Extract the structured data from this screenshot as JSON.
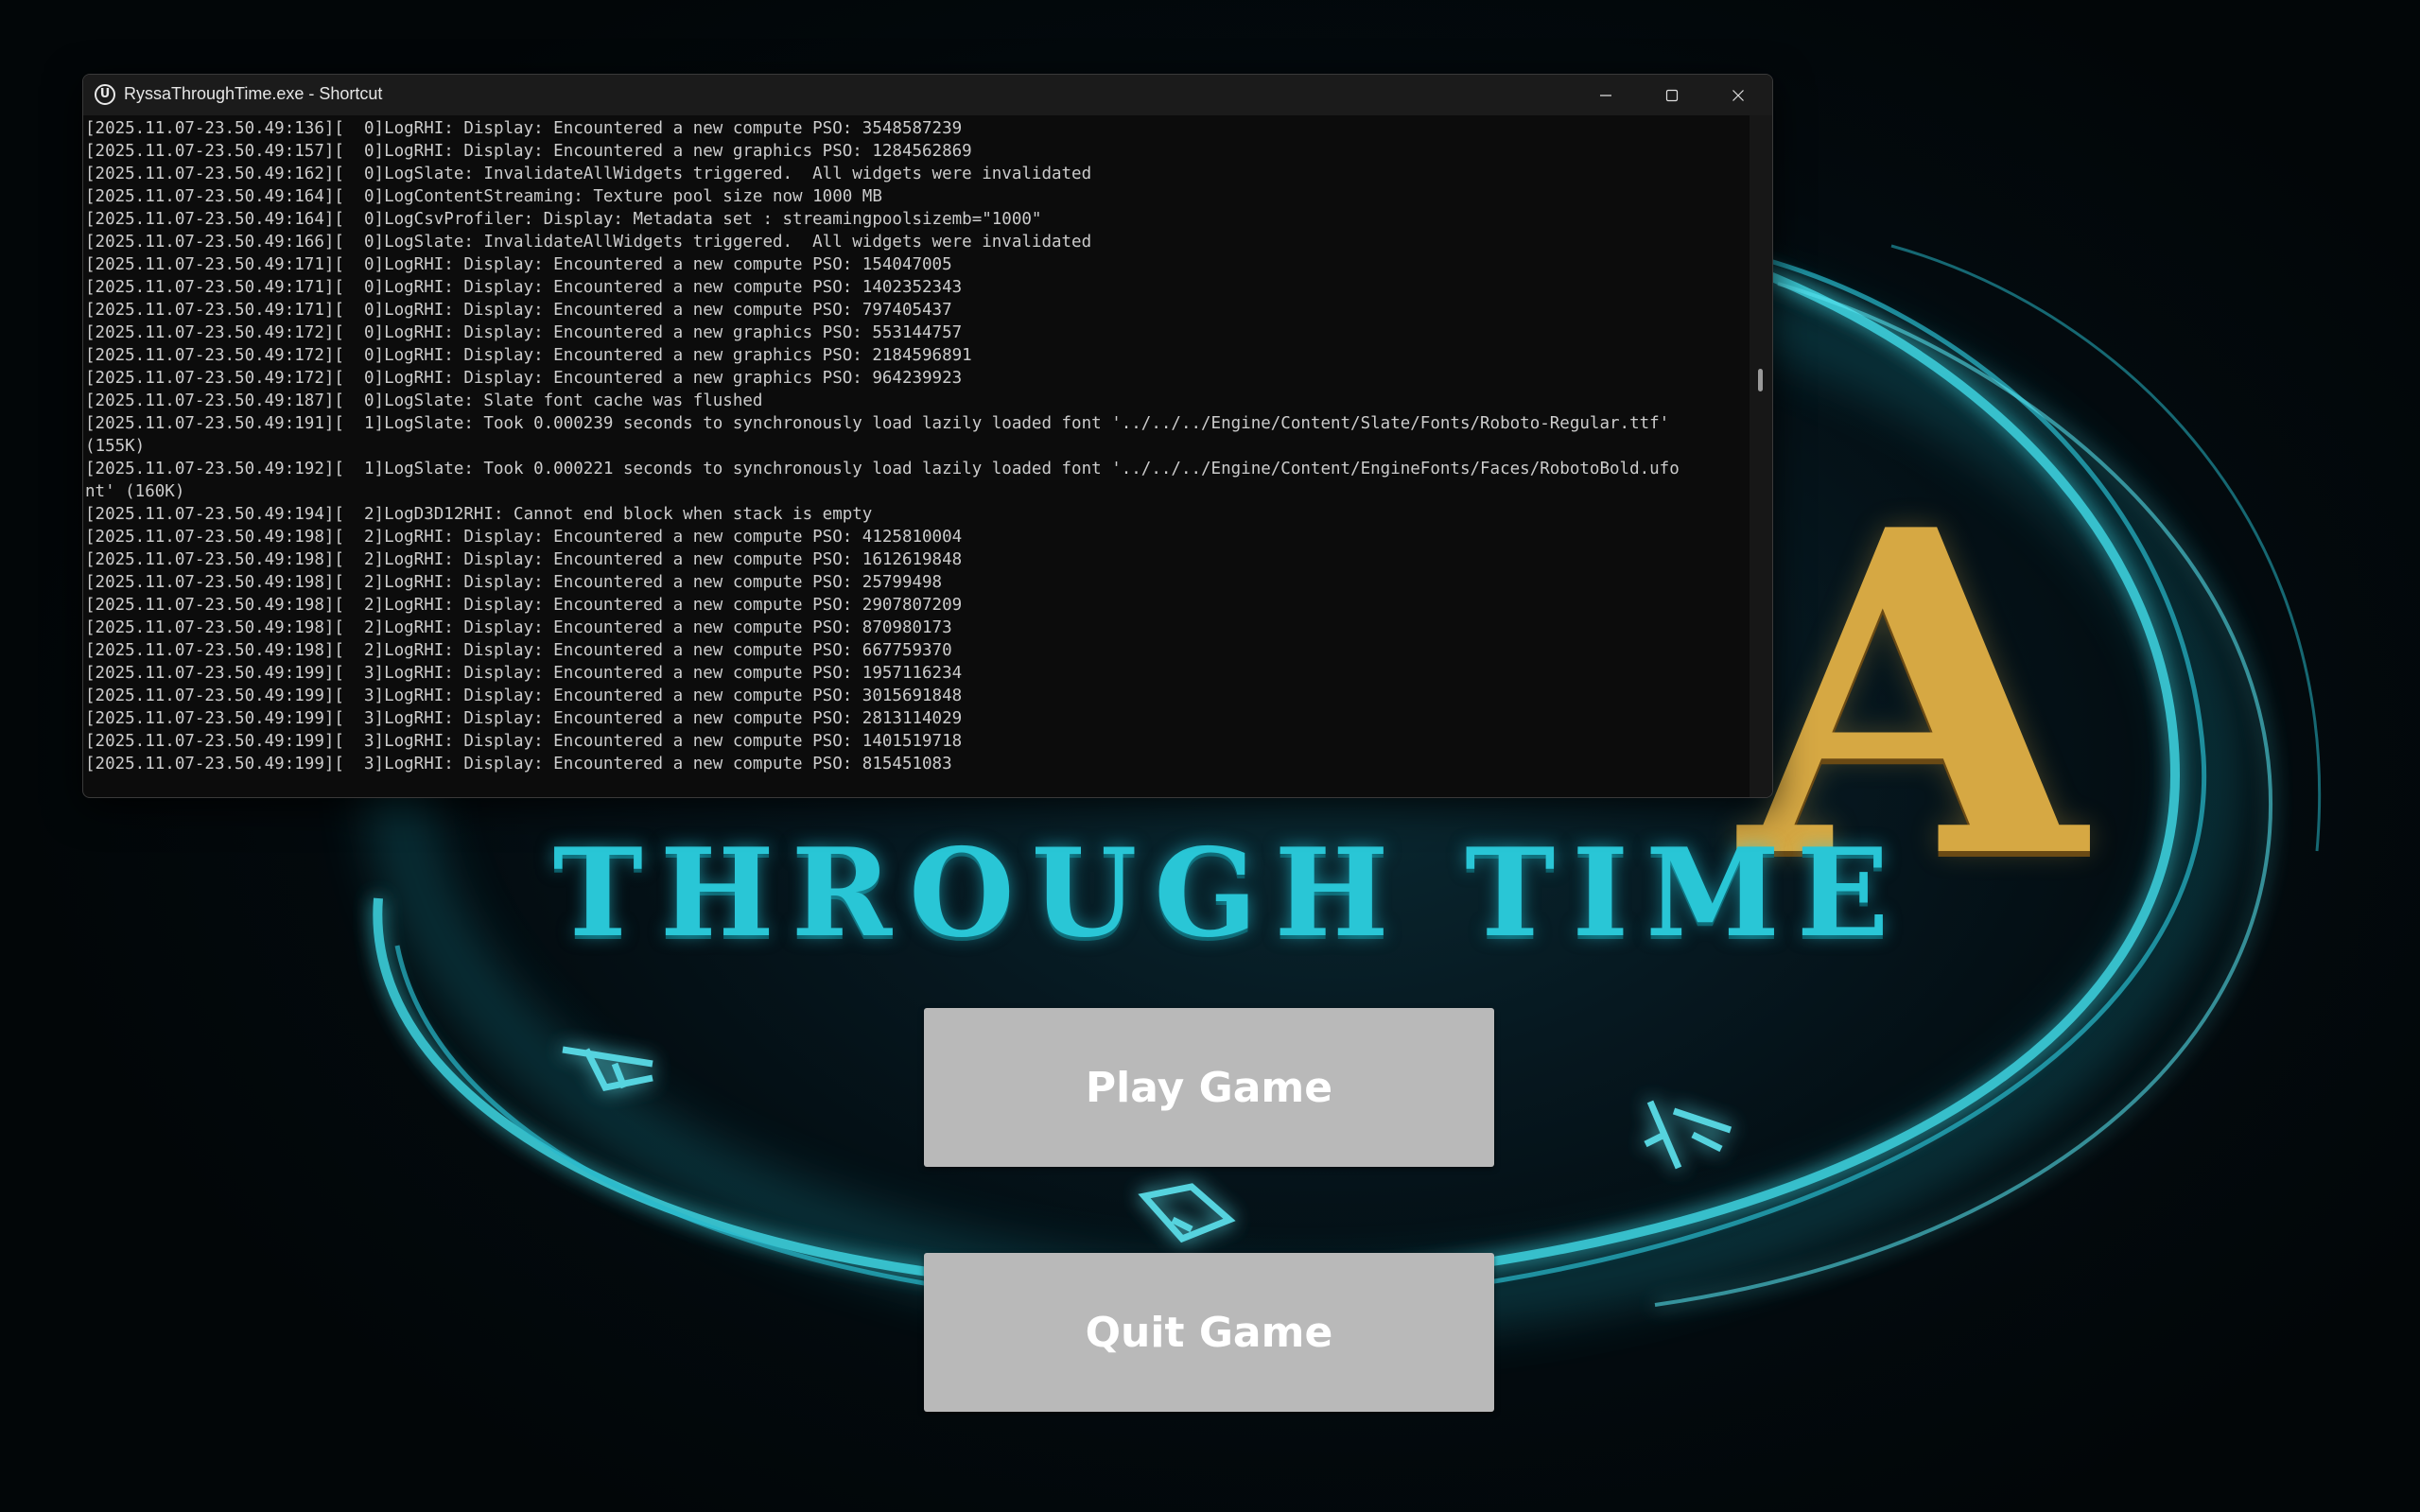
{
  "console": {
    "title": "RyssaThroughTime.exe - Shortcut",
    "icon": "unreal-engine-icon",
    "lines": [
      "[2025.11.07-23.50.49:136][  0]LogRHI: Display: Encountered a new compute PSO: 3548587239",
      "[2025.11.07-23.50.49:157][  0]LogRHI: Display: Encountered a new graphics PSO: 1284562869",
      "[2025.11.07-23.50.49:162][  0]LogSlate: InvalidateAllWidgets triggered.  All widgets were invalidated",
      "[2025.11.07-23.50.49:164][  0]LogContentStreaming: Texture pool size now 1000 MB",
      "[2025.11.07-23.50.49:164][  0]LogCsvProfiler: Display: Metadata set : streamingpoolsizemb=\"1000\"",
      "[2025.11.07-23.50.49:166][  0]LogSlate: InvalidateAllWidgets triggered.  All widgets were invalidated",
      "[2025.11.07-23.50.49:171][  0]LogRHI: Display: Encountered a new compute PSO: 154047005",
      "[2025.11.07-23.50.49:171][  0]LogRHI: Display: Encountered a new compute PSO: 1402352343",
      "[2025.11.07-23.50.49:171][  0]LogRHI: Display: Encountered a new compute PSO: 797405437",
      "[2025.11.07-23.50.49:172][  0]LogRHI: Display: Encountered a new graphics PSO: 553144757",
      "[2025.11.07-23.50.49:172][  0]LogRHI: Display: Encountered a new graphics PSO: 2184596891",
      "[2025.11.07-23.50.49:172][  0]LogRHI: Display: Encountered a new graphics PSO: 964239923",
      "[2025.11.07-23.50.49:187][  0]LogSlate: Slate font cache was flushed",
      "[2025.11.07-23.50.49:191][  1]LogSlate: Took 0.000239 seconds to synchronously load lazily loaded font '../../../Engine/Content/Slate/Fonts/Roboto-Regular.ttf'",
      "(155K)",
      "[2025.11.07-23.50.49:192][  1]LogSlate: Took 0.000221 seconds to synchronously load lazily loaded font '../../../Engine/Content/EngineFonts/Faces/RobotoBold.ufo",
      "nt' (160K)",
      "[2025.11.07-23.50.49:194][  2]LogD3D12RHI: Cannot end block when stack is empty",
      "[2025.11.07-23.50.49:198][  2]LogRHI: Display: Encountered a new compute PSO: 4125810004",
      "[2025.11.07-23.50.49:198][  2]LogRHI: Display: Encountered a new compute PSO: 1612619848",
      "[2025.11.07-23.50.49:198][  2]LogRHI: Display: Encountered a new compute PSO: 25799498",
      "[2025.11.07-23.50.49:198][  2]LogRHI: Display: Encountered a new compute PSO: 2907807209",
      "[2025.11.07-23.50.49:198][  2]LogRHI: Display: Encountered a new compute PSO: 870980173",
      "[2025.11.07-23.50.49:198][  2]LogRHI: Display: Encountered a new compute PSO: 667759370",
      "[2025.11.07-23.50.49:199][  3]LogRHI: Display: Encountered a new compute PSO: 1957116234",
      "[2025.11.07-23.50.49:199][  3]LogRHI: Display: Encountered a new compute PSO: 3015691848",
      "[2025.11.07-23.50.49:199][  3]LogRHI: Display: Encountered a new compute PSO: 2813114029",
      "[2025.11.07-23.50.49:199][  3]LogRHI: Display: Encountered a new compute PSO: 1401519718",
      "[2025.11.07-23.50.49:199][  3]LogRHI: Display: Encountered a new compute PSO: 815451083"
    ]
  },
  "game": {
    "title_subtitle": "THROUGH TIME",
    "title_partial_letter": "A",
    "play_label": "Play Game",
    "quit_label": "Quit Game",
    "colors": {
      "title_teal": "#29c6d6",
      "title_gold": "#d6a843",
      "button_bg": "#b9b9b9",
      "button_text": "#ffffff",
      "console_bg": "#0c0c0c",
      "console_text": "#cccccc"
    }
  }
}
